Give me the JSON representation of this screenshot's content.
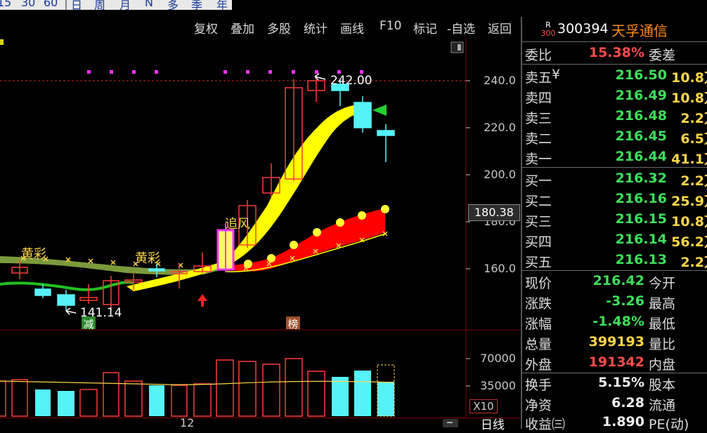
{
  "periods": [
    "15",
    "30",
    "60",
    "日",
    "周",
    "月",
    "N",
    "多",
    "季",
    "年"
  ],
  "toolbar": [
    "复权",
    "叠加",
    "多股",
    "统计",
    "画线",
    "F10",
    "标记",
    "-自选",
    "返回"
  ],
  "stock": {
    "badge_top": "R",
    "badge_bottom": "300",
    "code": "300394",
    "name": "天孚通信"
  },
  "colors": {
    "up": "#ff3b3b",
    "down": "#55f2f6",
    "accent": "#ffd64a",
    "ma_yellow": "#ffff00",
    "fill_red": "#ff0000",
    "green": "#3ee05a"
  },
  "main_axis": {
    "ticks": [
      "240.0",
      "220.0",
      "200.0",
      "180.0",
      "160.0"
    ],
    "crosshair_price": "180.38"
  },
  "annotations": {
    "high": "242.00",
    "low": "141.14",
    "label1": "黄彩",
    "label2": "黄彩",
    "label3": "追风",
    "tag_jian": "减",
    "tag_bang": "榜"
  },
  "vol_axis": {
    "ticks": [
      "70000",
      "35000"
    ],
    "unit": "X10"
  },
  "x_label": "12",
  "period_label": "日线",
  "quote": {
    "weibi_label": "委比",
    "weibi_value": "15.38%",
    "weicha_label": "委差",
    "asks": [
      {
        "label": "卖五",
        "price": "216.50",
        "vol": "10.8万"
      },
      {
        "label": "卖四",
        "price": "216.49",
        "vol": "10.8万"
      },
      {
        "label": "卖三",
        "price": "216.48",
        "vol": "2.2万"
      },
      {
        "label": "卖二",
        "price": "216.45",
        "vol": "6.5万"
      },
      {
        "label": "卖一",
        "price": "216.44",
        "vol": "41.1万"
      }
    ],
    "bids": [
      {
        "label": "买一",
        "price": "216.32",
        "vol": "2.2万"
      },
      {
        "label": "买二",
        "price": "216.16",
        "vol": "25.9万"
      },
      {
        "label": "买三",
        "price": "216.15",
        "vol": "10.8万"
      },
      {
        "label": "买四",
        "price": "216.14",
        "vol": "56.2万"
      },
      {
        "label": "买五",
        "price": "216.13",
        "vol": "2.2万"
      }
    ],
    "stats": [
      {
        "label": "现价",
        "value": "216.42",
        "label2": "今开",
        "cls": "green"
      },
      {
        "label": "涨跌",
        "value": "-3.26",
        "label2": "最高",
        "cls": "green"
      },
      {
        "label": "涨幅",
        "value": "-1.48%",
        "label2": "最低",
        "cls": "green"
      },
      {
        "label": "总量",
        "value": "399193",
        "label2": "量比",
        "cls": "yellow"
      },
      {
        "label": "外盘",
        "value": "191342",
        "label2": "内盘",
        "cls": "red"
      }
    ],
    "stats2": [
      {
        "label": "换手",
        "value": "5.15%",
        "label2": "股本",
        "cls": "white"
      },
      {
        "label": "净资",
        "value": "6.28",
        "label2": "流通",
        "cls": "white"
      },
      {
        "label": "收益㈢",
        "value": "1.890",
        "label2": "PE(动)",
        "cls": "white"
      }
    ]
  }
}
